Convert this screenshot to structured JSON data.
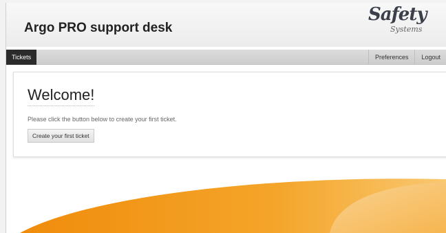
{
  "header": {
    "title": "Argo PRO support desk",
    "logo_text": "Safety",
    "logo_subtext": "Systems"
  },
  "nav": {
    "tickets_label": "Tickets",
    "preferences_label": "Preferences",
    "logout_label": "Logout"
  },
  "main": {
    "heading": "Welcome!",
    "instruction": "Please click the button below to create your first ticket.",
    "button_label": "Create your first ticket"
  },
  "colors": {
    "accent_orange": "#f39a12",
    "nav_active": "#2b2b2b"
  }
}
